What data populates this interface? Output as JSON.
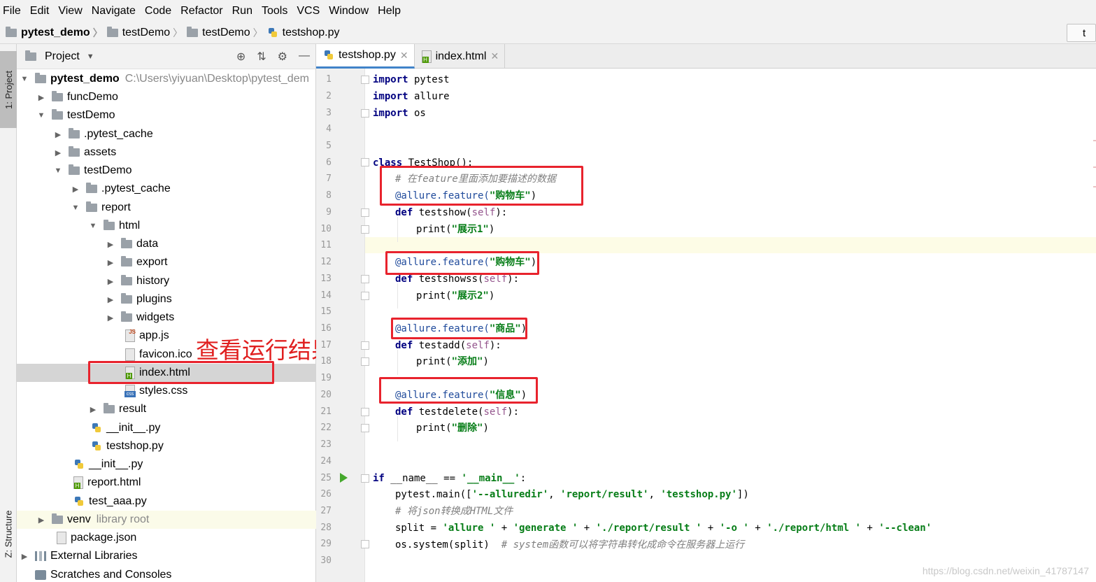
{
  "menu": [
    "File",
    "Edit",
    "View",
    "Navigate",
    "Code",
    "Refactor",
    "Run",
    "Tools",
    "VCS",
    "Window",
    "Help"
  ],
  "menu_mnemonics": [
    "F",
    "E",
    "V",
    "N",
    "C",
    "R",
    "R",
    "T",
    "S",
    "W",
    "H"
  ],
  "breadcrumbs": [
    "pytest_demo",
    "testDemo",
    "testDemo",
    "testshop.py"
  ],
  "nav_right_text": "t",
  "side_tabs": {
    "project": "1: Project",
    "structure": "Z: Structure"
  },
  "project_panel": {
    "title": "Project",
    "tree": [
      {
        "label": "pytest_demo",
        "hint": "C:\\Users\\yiyuan\\Desktop\\pytest_dem"
      },
      {
        "label": "funcDemo"
      },
      {
        "label": "testDemo"
      },
      {
        "label": ".pytest_cache"
      },
      {
        "label": "assets"
      },
      {
        "label": "testDemo"
      },
      {
        "label": ".pytest_cache"
      },
      {
        "label": "report"
      },
      {
        "label": "html"
      },
      {
        "label": "data"
      },
      {
        "label": "export"
      },
      {
        "label": "history"
      },
      {
        "label": "plugins"
      },
      {
        "label": "widgets"
      },
      {
        "label": "app.js"
      },
      {
        "label": "favicon.ico"
      },
      {
        "label": "index.html"
      },
      {
        "label": "styles.css"
      },
      {
        "label": "result"
      },
      {
        "label": "__init__.py"
      },
      {
        "label": "testshop.py"
      },
      {
        "label": "__init__.py"
      },
      {
        "label": "report.html"
      },
      {
        "label": "test_aaa.py"
      },
      {
        "label": "venv",
        "hint": "library root"
      },
      {
        "label": "package.json"
      },
      {
        "label": "External Libraries"
      },
      {
        "label": "Scratches and Consoles"
      }
    ]
  },
  "annotation": "查看运行结果",
  "editor_tabs": [
    {
      "label": "testshop.py",
      "active": true
    },
    {
      "label": "index.html",
      "active": false
    }
  ],
  "line_numbers": [
    "1",
    "2",
    "3",
    "4",
    "5",
    "6",
    "7",
    "8",
    "9",
    "10",
    "11",
    "12",
    "13",
    "14",
    "15",
    "16",
    "17",
    "18",
    "19",
    "20",
    "21",
    "22",
    "23",
    "24",
    "25",
    "26",
    "27",
    "28",
    "29",
    "30"
  ],
  "code": {
    "l1": {
      "kw": "import",
      "rest": " pytest"
    },
    "l2": {
      "kw": "import",
      "rest": " allure"
    },
    "l3": {
      "kw": "import",
      "rest": " os"
    },
    "l6": {
      "kw": "class",
      "rest": " TestShop():"
    },
    "l7": "# 在feature里面添加要描述的数据",
    "l8": {
      "deco": "@allure.feature(",
      "str": "\"购物车\"",
      "end": ")"
    },
    "l9": {
      "kw": "def",
      "name": " testshow(",
      "self": "self",
      "end": "):"
    },
    "l10": {
      "fn": "print(",
      "str": "\"展示1\"",
      "end": ")"
    },
    "l12": {
      "deco": "@allure.feature(",
      "str": "\"购物车\"",
      "end": ")"
    },
    "l13": {
      "kw": "def",
      "name": " testshowss(",
      "self": "self",
      "end": "):"
    },
    "l14": {
      "fn": "print(",
      "str": "\"展示2\"",
      "end": ")"
    },
    "l16": {
      "deco": "@allure.feature(",
      "str": "\"商品\"",
      "end": ")"
    },
    "l17": {
      "kw": "def",
      "name": " testadd(",
      "self": "self",
      "end": "):"
    },
    "l18": {
      "fn": "print(",
      "str": "\"添加\"",
      "end": ")"
    },
    "l20": {
      "deco": "@allure.feature(",
      "str": "\"信息\"",
      "end": ")"
    },
    "l21": {
      "kw": "def",
      "name": " testdelete(",
      "self": "self",
      "end": "):"
    },
    "l22": {
      "fn": "print(",
      "str": "\"删除\"",
      "end": ")"
    },
    "l25": {
      "kw": "if",
      "a": " __name__ == ",
      "str": "'__main__'",
      "end": ":"
    },
    "l26": {
      "a": "pytest.main([",
      "s1": "'--alluredir'",
      "c1": ", ",
      "s2": "'report/result'",
      "c2": ", ",
      "s3": "'testshop.py'",
      "end": "])"
    },
    "l27": "# 将json转换成HTML文件",
    "l28": {
      "a": "split = ",
      "s1": "'allure '",
      "p1": " + ",
      "s2": "'generate '",
      "p2": " + ",
      "s3": "'./report/result '",
      "p3": " + ",
      "s4": "'-o '",
      "p4": " + ",
      "s5": "'./report/html '",
      "p5": " + ",
      "s6": "'--clean'"
    },
    "l29": {
      "a": "os.system(split)  ",
      "cm": "# system函数可以将字符串转化成命令在服务器上运行"
    }
  },
  "watermark": "https://blog.csdn.net/weixin_41787147",
  "colors": {
    "keyword": "#000080",
    "string": "#067d17",
    "comment": "#808080",
    "annotation_red": "#e8232d",
    "tab_accent": "#4083c9"
  }
}
